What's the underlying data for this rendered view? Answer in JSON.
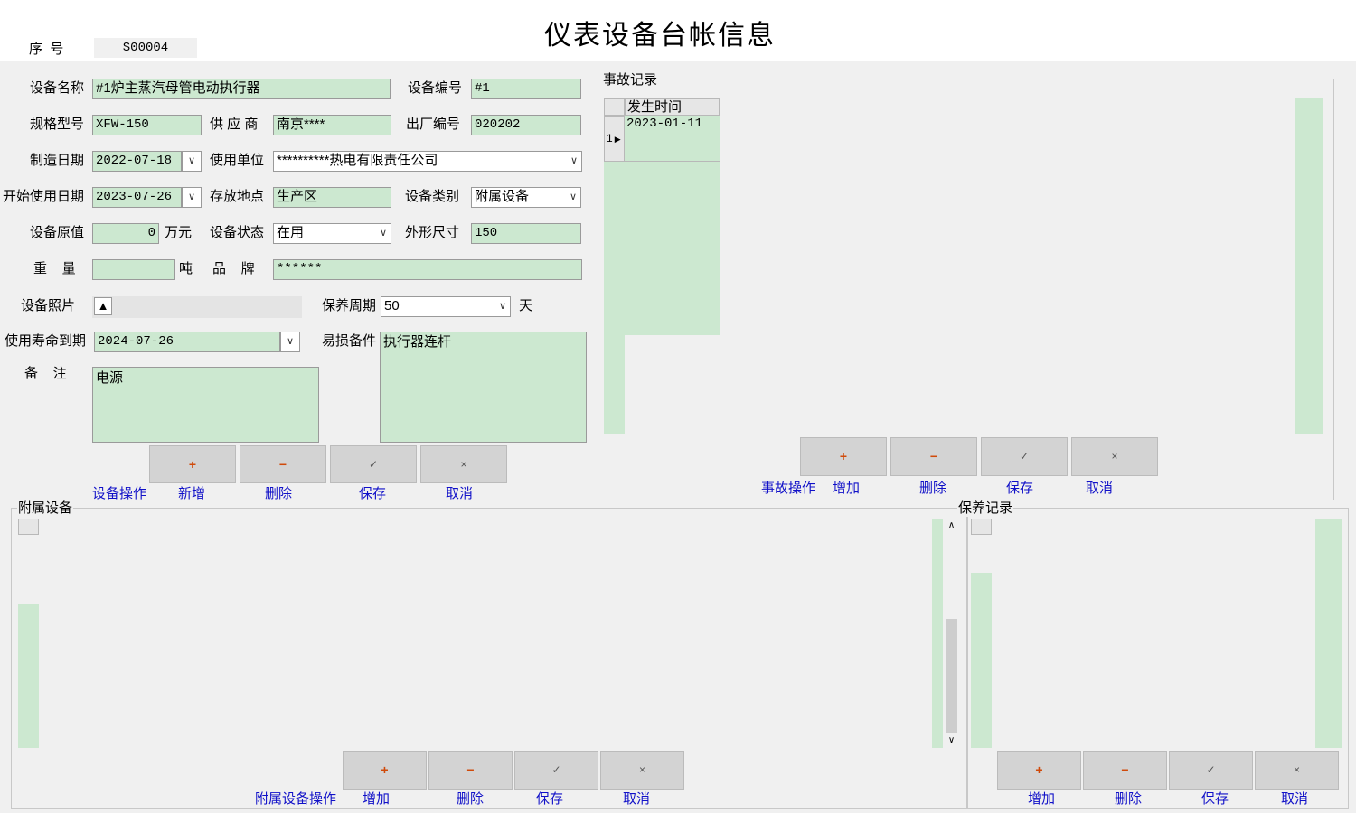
{
  "title": "仪表设备台帐信息",
  "serial": {
    "label": "序  号",
    "value": "S00004"
  },
  "form": {
    "device_name_label": "设备名称",
    "device_name": "#1炉主蒸汽母管电动执行器",
    "device_no_label": "设备编号",
    "device_no": "#1",
    "spec_label": "规格型号",
    "spec": "XFW-150",
    "supplier_label": "供 应 商",
    "supplier": "南京****",
    "factory_no_label": "出厂编号",
    "factory_no": "020202",
    "mfg_date_label": "制造日期",
    "mfg_date": "2022-07-18",
    "unit_label": "使用单位",
    "unit": "**********热电有限责任公司",
    "start_date_label": "开始使用日期",
    "start_date": "2023-07-26",
    "location_label": "存放地点",
    "location": "生产区",
    "category_label": "设备类别",
    "category": "附属设备",
    "orig_value_label": "设备原值",
    "orig_value": "0",
    "orig_value_unit": "万元",
    "status_label": "设备状态",
    "status": "在用",
    "size_label": "外形尺寸",
    "size": "150",
    "weight_label": "重    量",
    "weight": "",
    "weight_unit": "吨",
    "brand_label": "品    牌",
    "brand": "******",
    "photo_label": "设备照片",
    "cycle_label": "保养周期",
    "cycle": "50",
    "cycle_unit": "天",
    "life_label": "使用寿命到期",
    "life": "2024-07-26",
    "parts_label": "易损备件",
    "parts": "执行器连杆",
    "remark_label": "备    注",
    "remark": "电源"
  },
  "device_ops": {
    "label": "设备操作",
    "add": "新增",
    "delete": "删除",
    "save": "保存",
    "cancel": "取消"
  },
  "accident": {
    "title": "事故记录",
    "column": "发生时间",
    "rows": [
      {
        "index": "1",
        "time": "2023-01-11"
      }
    ],
    "ops": {
      "label": "事故操作",
      "add": "增加",
      "delete": "删除",
      "save": "保存",
      "cancel": "取消"
    }
  },
  "attached": {
    "title": "附属设备",
    "ops": {
      "label": "附属设备操作",
      "add": "增加",
      "delete": "删除",
      "save": "保存",
      "cancel": "取消"
    }
  },
  "maintenance": {
    "title": "保养记录",
    "ops": {
      "add": "增加",
      "delete": "删除",
      "save": "保存",
      "cancel": "取消"
    }
  },
  "glyphs": {
    "plus": "+",
    "minus": "−",
    "check": "✓",
    "x": "×",
    "dropdown": "∨",
    "up": "∧",
    "down": "∨"
  },
  "colors": {
    "field_bg": "#cce8d0",
    "link_blue": "#1010c8",
    "button_bg": "#d3d3d3",
    "accent_orange": "#d04a0a"
  }
}
